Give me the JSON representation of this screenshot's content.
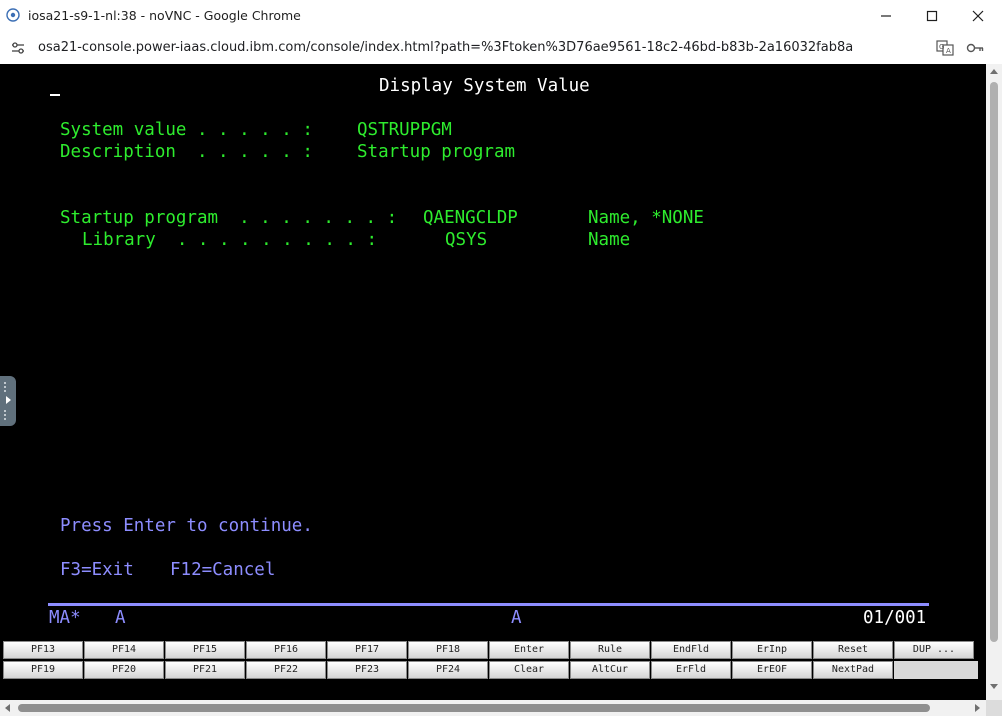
{
  "window": {
    "title": "iosa21-s9-1-nl:38 - noVNC - Google Chrome"
  },
  "address_bar": {
    "url": "osa21-console.power-iaas.cloud.ibm.com/console/index.html?path=%3Ftoken%3D76ae9561-18c2-46bd-b83b-2a16032fab8a"
  },
  "terminal": {
    "screen_title": "Display System Value",
    "system_value_label": "System value . . . . . :",
    "system_value": "QSTRUPPGM",
    "description_label": "Description  . . . . . :",
    "description": "Startup program",
    "startup_program_label": "Startup program  . . . . . . . :",
    "startup_program_value": "QAENGCLDP",
    "startup_program_hint": "Name, *NONE",
    "library_label": "Library  . . . . . . . . . :",
    "library_value": "QSYS",
    "library_hint": "Name",
    "message": "Press Enter to continue.",
    "f3": "F3=Exit",
    "f12": "F12=Cancel",
    "status_left": "MA*",
    "status_a1": "A",
    "status_a2": "A",
    "status_pos": "01/001"
  },
  "keypad": {
    "row1": [
      "PF13",
      "PF14",
      "PF15",
      "PF16",
      "PF17",
      "PF18",
      "Enter",
      "Rule",
      "EndFld",
      "ErInp",
      "Reset",
      "DUP ..."
    ],
    "row2": [
      "PF19",
      "PF20",
      "PF21",
      "PF22",
      "PF23",
      "PF24",
      "Clear",
      "AltCur",
      "ErFld",
      "ErEOF",
      "NextPad"
    ]
  },
  "colors": {
    "terminal_green": "#2eec2e",
    "terminal_blue": "#8d8dff",
    "terminal_white": "#ffffff",
    "background": "#000000"
  },
  "icons": {
    "app": "novnc-icon",
    "minimize": "minimize-icon",
    "maximize": "maximize-icon",
    "close": "close-icon",
    "site_settings": "tune-icon",
    "translate": "translate-icon",
    "password": "key-icon",
    "panel_toggle": "chevron-right-icon"
  }
}
